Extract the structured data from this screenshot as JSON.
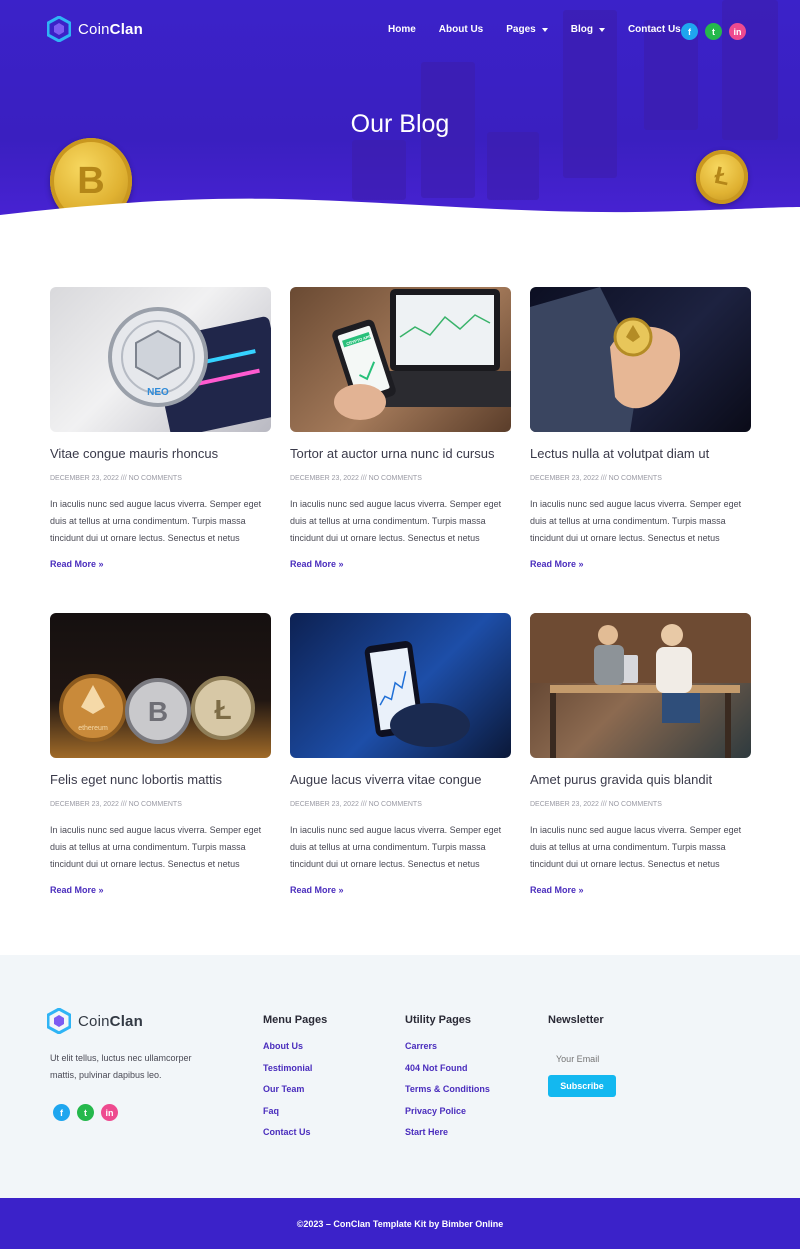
{
  "brand": {
    "name_light": "Coin",
    "name_bold": "Clan"
  },
  "nav": {
    "home": "Home",
    "about": "About Us",
    "pages": "Pages",
    "blog": "Blog",
    "contact": "Contact Us"
  },
  "social": {
    "facebook": "f",
    "twitter": "t",
    "linkedin": "in"
  },
  "hero": {
    "title": "Our Blog",
    "coin_left": "B",
    "coin_right": "Ł"
  },
  "posts": [
    {
      "title": "Vitae congue mauris rhoncus",
      "meta": "December 23, 2022 /// No Comments",
      "excerpt": "In iaculis nunc sed augue lacus viverra. Semper eget duis at tellus at urna condimentum. Turpis massa tincidunt dui ut ornare lectus. Senectus et netus",
      "more": "Read More »"
    },
    {
      "title": "Tortor at auctor urna nunc id cursus",
      "meta": "December 23, 2022 /// No Comments",
      "excerpt": "In iaculis nunc sed augue lacus viverra. Semper eget duis at tellus at urna condimentum. Turpis massa tincidunt dui ut ornare lectus. Senectus et netus",
      "more": "Read More »"
    },
    {
      "title": "Lectus nulla at volutpat diam ut",
      "meta": "December 23, 2022 /// No Comments",
      "excerpt": "In iaculis nunc sed augue lacus viverra. Semper eget duis at tellus at urna condimentum. Turpis massa tincidunt dui ut ornare lectus. Senectus et netus",
      "more": "Read More »"
    },
    {
      "title": "Felis eget nunc lobortis mattis",
      "meta": "December 23, 2022 /// No Comments",
      "excerpt": "In iaculis nunc sed augue lacus viverra. Semper eget duis at tellus at urna condimentum. Turpis massa tincidunt dui ut ornare lectus. Senectus et netus",
      "more": "Read More »"
    },
    {
      "title": "Augue lacus viverra vitae congue",
      "meta": "December 23, 2022 /// No Comments",
      "excerpt": "In iaculis nunc sed augue lacus viverra. Semper eget duis at tellus at urna condimentum. Turpis massa tincidunt dui ut ornare lectus. Senectus et netus",
      "more": "Read More »"
    },
    {
      "title": "Amet purus gravida quis blandit",
      "meta": "December 23, 2022 /// No Comments",
      "excerpt": "In iaculis nunc sed augue lacus viverra. Semper eget duis at tellus at urna condimentum. Turpis massa tincidunt dui ut ornare lectus. Senectus et netus",
      "more": "Read More »"
    }
  ],
  "thumb_labels": {
    "neo": "NEO",
    "app": "CRYPTO APP",
    "eth": "ethereum"
  },
  "footer": {
    "about": "Ut elit tellus, luctus nec ullamcorper mattis, pulvinar dapibus leo.",
    "menu_head": "Menu Pages",
    "menu": [
      "About Us",
      "Testimonial",
      "Our Team",
      "Faq",
      "Contact Us"
    ],
    "utility_head": "Utility Pages",
    "utility": [
      "Carrers",
      "404 Not Found",
      "Terms & Conditions",
      "Privacy Police",
      "Start Here"
    ],
    "newsletter_head": "Newsletter",
    "email_placeholder": "Your Email",
    "subscribe": "Subscribe",
    "copyright": "©2023 – ConClan Template Kit by Bimber Online"
  },
  "colors": {
    "primary": "#3b22c9",
    "link": "#4a2dbd",
    "accent": "#13b8f0",
    "footer_bg": "#f2f6f9"
  }
}
